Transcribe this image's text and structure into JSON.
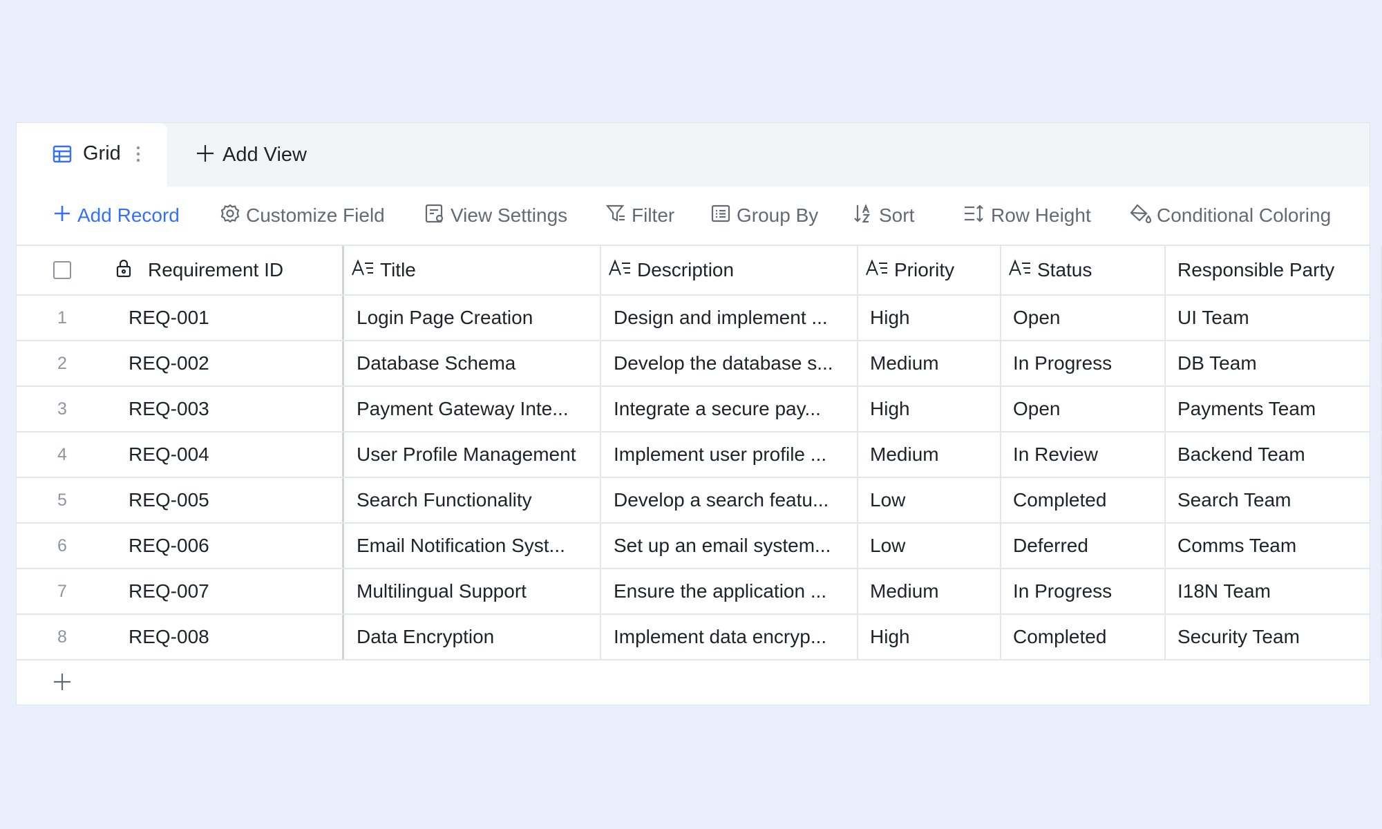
{
  "tabs": {
    "active": "Grid",
    "add_view": "Add View"
  },
  "toolbar": {
    "add_record": "Add Record",
    "customize_field": "Customize Field",
    "view_settings": "View Settings",
    "filter": "Filter",
    "group_by": "Group By",
    "sort": "Sort",
    "row_height": "Row Height",
    "conditional_coloring": "Conditional Coloring"
  },
  "columns": {
    "id": "Requirement ID",
    "title": "Title",
    "description": "Description",
    "priority": "Priority",
    "status": "Status",
    "responsible": "Responsible Party"
  },
  "rows": [
    {
      "index": "1",
      "id": "REQ-001",
      "title": "Login Page Creation",
      "description": "Design and implement ...",
      "priority": "High",
      "status": "Open",
      "responsible": "UI Team"
    },
    {
      "index": "2",
      "id": "REQ-002",
      "title": "Database Schema",
      "description": "Develop the database s...",
      "priority": "Medium",
      "status": "In Progress",
      "responsible": "DB Team"
    },
    {
      "index": "3",
      "id": "REQ-003",
      "title": "Payment Gateway Inte...",
      "description": "Integrate a secure pay...",
      "priority": "High",
      "status": "Open",
      "responsible": "Payments Team"
    },
    {
      "index": "4",
      "id": "REQ-004",
      "title": "User Profile Management",
      "description": "Implement user profile ...",
      "priority": "Medium",
      "status": "In Review",
      "responsible": "Backend Team"
    },
    {
      "index": "5",
      "id": "REQ-005",
      "title": "Search Functionality",
      "description": "Develop a search featu...",
      "priority": "Low",
      "status": "Completed",
      "responsible": "Search Team"
    },
    {
      "index": "6",
      "id": "REQ-006",
      "title": "Email Notification Syst...",
      "description": "Set up an email system...",
      "priority": "Low",
      "status": "Deferred",
      "responsible": "Comms Team"
    },
    {
      "index": "7",
      "id": "REQ-007",
      "title": "Multilingual Support",
      "description": "Ensure the application ...",
      "priority": "Medium",
      "status": "In Progress",
      "responsible": "I18N Team"
    },
    {
      "index": "8",
      "id": "REQ-008",
      "title": "Data Encryption",
      "description": "Implement data encryp...",
      "priority": "High",
      "status": "Completed",
      "responsible": "Security Team"
    }
  ],
  "icons": {
    "grid_tab": "table-grid-icon",
    "tab_menu": "more-vertical-icon",
    "add_view": "plus-icon",
    "add_record": "plus-icon",
    "customize_field": "gear-icon",
    "view_settings": "view-settings-icon",
    "filter": "filter-icon",
    "group_by": "group-list-icon",
    "sort": "sort-az-icon",
    "row_height": "row-height-icon",
    "conditional_coloring": "paint-bucket-icon",
    "id_column": "lock-icon",
    "text_field": "text-field-icon",
    "add_row": "plus-icon"
  },
  "colors": {
    "accent": "#3370ff",
    "notification_dot": "#f04438",
    "background": "#e9effc"
  }
}
